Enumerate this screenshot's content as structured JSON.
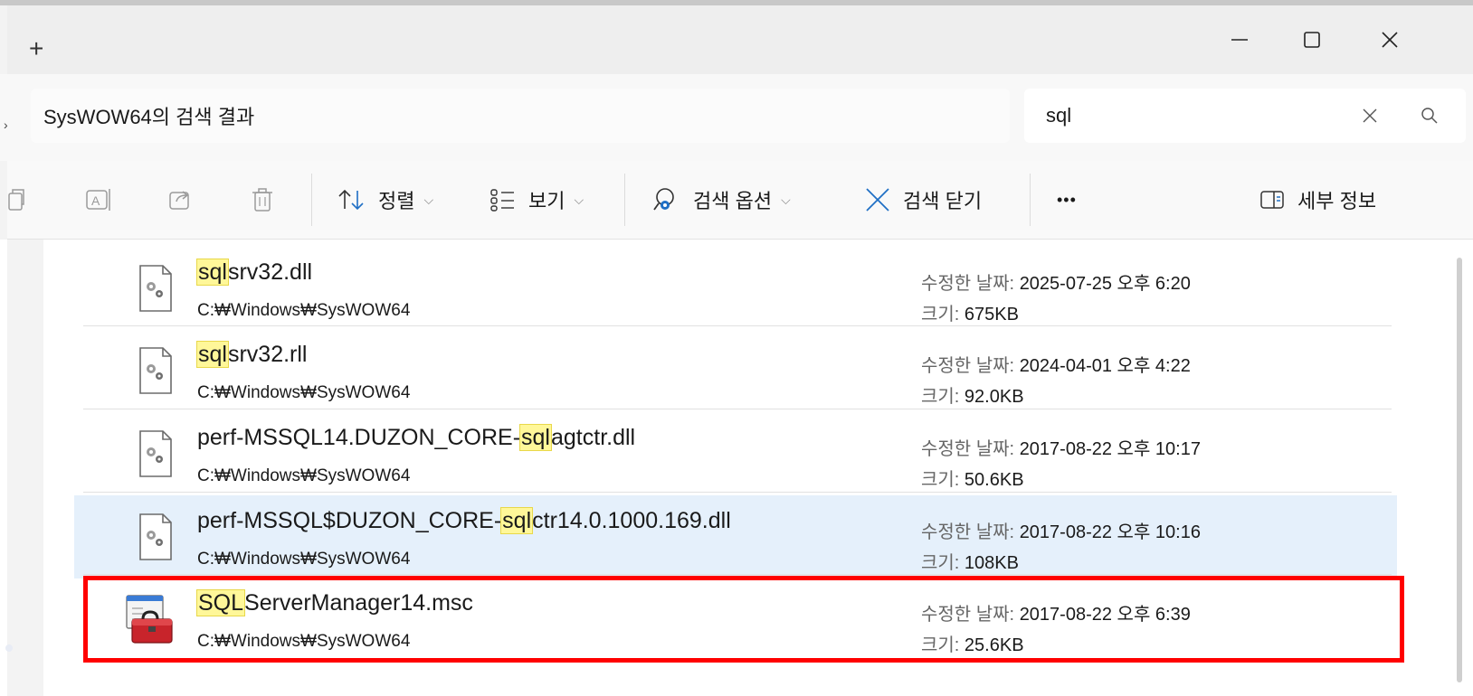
{
  "titlebar": {
    "new_tab": "+",
    "minimize_icon": "minimize-icon",
    "maximize_icon": "maximize-icon",
    "close_icon": "close-icon"
  },
  "address": {
    "text": "SysWOW64의 검색 결과"
  },
  "search": {
    "value": "sql"
  },
  "toolbar": {
    "sort_label": "정렬",
    "view_label": "보기",
    "search_options_label": "검색 옵션",
    "close_search_label": "검색 닫기",
    "more_label": "•••",
    "details_label": "세부 정보"
  },
  "files": [
    {
      "pre": "",
      "match": "sql",
      "post": "srv32.dll",
      "path": "C:₩Windows₩SysWOW64",
      "date_key": "수정한 날짜:",
      "date": "2025-07-25 오후 6:20",
      "size_key": "크기:",
      "size": "675KB",
      "icon": "dll-file-icon"
    },
    {
      "pre": "",
      "match": "sql",
      "post": "srv32.rll",
      "path": "C:₩Windows₩SysWOW64",
      "date_key": "수정한 날짜:",
      "date": "2024-04-01 오후 4:22",
      "size_key": "크기:",
      "size": "92.0KB",
      "icon": "dll-file-icon"
    },
    {
      "pre": "perf-MSSQL14.DUZON_CORE-",
      "match": "sql",
      "post": "agtctr.dll",
      "path": "C:₩Windows₩SysWOW64",
      "date_key": "수정한 날짜:",
      "date": "2017-08-22 오후 10:17",
      "size_key": "크기:",
      "size": "50.6KB",
      "icon": "dll-file-icon"
    },
    {
      "pre": "perf-MSSQL$DUZON_CORE-",
      "match": "sql",
      "post": "ctr14.0.1000.169.dll",
      "path": "C:₩Windows₩SysWOW64",
      "date_key": "수정한 날짜:",
      "date": "2017-08-22 오후 10:16",
      "size_key": "크기:",
      "size": "108KB",
      "icon": "dll-file-icon"
    },
    {
      "pre": "",
      "match": "SQL",
      "post": "ServerManager14.msc",
      "path": "C:₩Windows₩SysWOW64",
      "date_key": "수정한 날짜:",
      "date": "2017-08-22 오후 6:39",
      "size_key": "크기:",
      "size": "25.6KB",
      "icon": "msc-toolbox-icon"
    }
  ],
  "colors": {
    "selected_row": "#e5f0fb",
    "match_highlight": "#fff799",
    "annotation_box": "#ff0000"
  }
}
